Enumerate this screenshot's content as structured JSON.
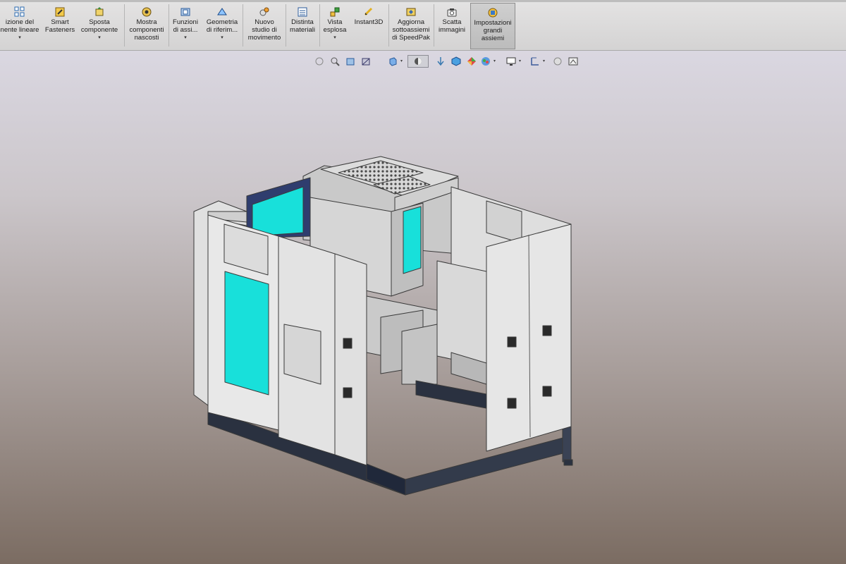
{
  "ribbon": {
    "items": [
      {
        "id": "linear-pattern",
        "label": "izione del\nnente lineare",
        "icon": "linear-pattern-icon",
        "dropdown": true
      },
      {
        "id": "smart-fasteners",
        "label": "Smart\nFasteners",
        "icon": "smart-fasteners-icon",
        "dropdown": false
      },
      {
        "id": "move-component",
        "label": "Sposta\ncomponente",
        "icon": "move-component-icon",
        "dropdown": true
      },
      {
        "id": "show-hidden",
        "label": "Mostra\ncomponenti\nnascosti",
        "icon": "show-hidden-icon",
        "dropdown": false
      },
      {
        "id": "assembly-features",
        "label": "Funzioni\ndi assi...",
        "icon": "assembly-features-icon",
        "dropdown": true
      },
      {
        "id": "reference-geometry",
        "label": "Geometria\ndi riferim...",
        "icon": "reference-geometry-icon",
        "dropdown": true
      },
      {
        "id": "new-motion-study",
        "label": "Nuovo\nstudio di\nmovimento",
        "icon": "motion-study-icon",
        "dropdown": false
      },
      {
        "id": "bill-of-materials",
        "label": "Distinta\nmateriali",
        "icon": "bill-of-materials-icon",
        "dropdown": false
      },
      {
        "id": "exploded-view",
        "label": "Vista\nesplosa",
        "icon": "exploded-view-icon",
        "dropdown": true
      },
      {
        "id": "instant3d",
        "label": "Instant3D",
        "icon": "instant3d-icon",
        "dropdown": false
      },
      {
        "id": "speedpak",
        "label": "Aggiorna\nsottoassiemi\ndi SpeedPak",
        "icon": "speedpak-icon",
        "dropdown": false
      },
      {
        "id": "take-snapshot",
        "label": "Scatta\nimmagini",
        "icon": "camera-icon",
        "dropdown": false
      },
      {
        "id": "large-assembly",
        "label": "Impostazioni\ngrandi\nassiemi",
        "icon": "large-assembly-icon",
        "dropdown": false,
        "active": true
      }
    ]
  },
  "hud": {
    "tools": [
      "zoom-to-fit-icon",
      "zoom-to-area-icon",
      "previous-view-icon",
      "section-view-icon",
      "view-orientation-icon",
      "display-style-icon",
      "hide-show-items-icon",
      "edit-appearance-icon",
      "apply-scene-icon",
      "view-settings-icon",
      "view-selector-icon"
    ]
  },
  "colors": {
    "accent_active": "#bcbcbc",
    "panel_gray": "#e6e6e6",
    "window_cyan": "#18e0da",
    "base_navy": "#2a3140",
    "viewport_top": "#dad7e1",
    "viewport_bottom": "#7b6c62"
  }
}
